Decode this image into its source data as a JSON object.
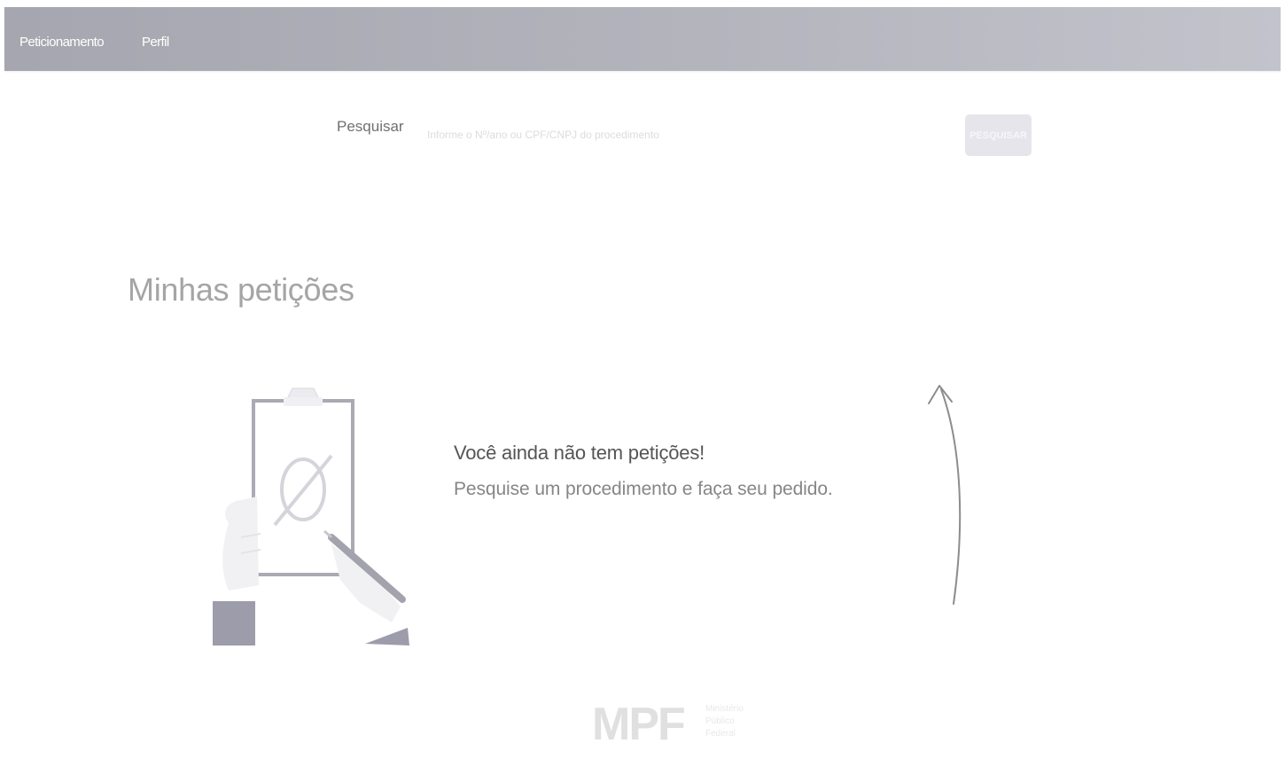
{
  "navbar": {
    "items": [
      {
        "label": "Peticionamento"
      },
      {
        "label": "Perfil"
      }
    ],
    "colors": {
      "background": "#b2b2bb",
      "text": "#ffffff"
    }
  },
  "search": {
    "label": "Pesquisar",
    "placeholder": "Informe o Nº/ano ou CPF/CNPJ do procedimento",
    "value": "",
    "button_label": "PESQUISAR",
    "button_color": "#e7e5ec"
  },
  "main": {
    "title": "Minhas petições",
    "empty_state": {
      "title": "Você ainda não tem petições!",
      "subtitle": "Pesquise um procedimento e faça seu pedido.",
      "illustration_icon": "clipboard-empty-set-icon",
      "arrow_icon": "curved-arrow-up-icon"
    }
  },
  "footer": {
    "logo_mark": "MPF",
    "logo_text_lines": [
      "Ministério",
      "Público",
      "Federal"
    ]
  }
}
